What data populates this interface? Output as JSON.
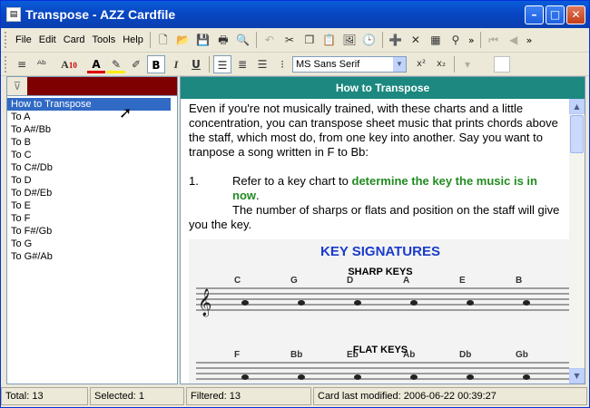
{
  "window": {
    "title": "Transpose - AZZ Cardfile",
    "icon": "cardfile-icon"
  },
  "menu": [
    "File",
    "Edit",
    "Card",
    "Tools",
    "Help"
  ],
  "format": {
    "font_size": "10",
    "font_name": "MS Sans Serif",
    "bold": "B",
    "italic": "I",
    "underline": "U",
    "superscript": "x²",
    "subscript": "x₂"
  },
  "cards": [
    "How to Transpose",
    "To A",
    "To A#/Bb",
    "To B",
    "To C",
    "To C#/Db",
    "To D",
    "To D#/Eb",
    "To E",
    "To F",
    "To F#/Gb",
    "To G",
    "To G#/Ab"
  ],
  "selected_card": "How to Transpose",
  "card": {
    "title": "How to Transpose",
    "intro": "Even if you're not musically trained, with these charts and a little concentration, you can transpose sheet music that prints chords above the staff, which most do, from one key into another.   Say you want to tranpose a song written in F to Bb:",
    "step_number": "1.",
    "step_text": "Refer to a key chart to ",
    "step_highlight": "determine the key the music is in now",
    "step_end": ".",
    "step_detail": "The number of sharps or flats and position on the staff will give you the key.",
    "image": {
      "title": "KEY SIGNATURES",
      "sharp": "SHARP KEYS",
      "flat": "FLAT KEYS",
      "sharp_notes": [
        "C",
        "G",
        "D",
        "A",
        "E",
        "B"
      ],
      "flat_notes": [
        "F",
        "Bb",
        "Eb",
        "Ab",
        "Db",
        "Gb"
      ]
    }
  },
  "status": {
    "total": "Total: 13",
    "selected": "Selected: 1",
    "filtered": "Filtered: 13",
    "modified": "Card last modified: 2006-06-22  00:39:27"
  },
  "colors": {
    "titlebar": "#0a5ddb",
    "card_header": "#1c8880",
    "filter_bar": "#7f0000",
    "selection": "#316ac5",
    "highlight_text": "#228b22"
  }
}
